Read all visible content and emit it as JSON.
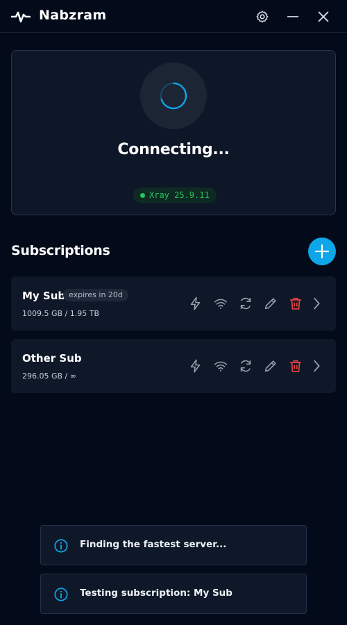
{
  "app": {
    "title": "Nabzram"
  },
  "titlebar": {
    "icons": [
      "pulse-logo-icon",
      "gear-icon",
      "minimize-icon",
      "close-icon"
    ]
  },
  "status": {
    "text": "Connecting...",
    "core_label": "Xray 25.9.11",
    "core_color": "#22c55e",
    "accent": "#0ea5e9"
  },
  "subscriptions": {
    "title": "Subscriptions",
    "items": [
      {
        "name": "My Sub",
        "badge": "expires in 20d",
        "usage": "1009.5 GB / 1.95 TB"
      },
      {
        "name": "Other Sub",
        "badge": "",
        "usage": "296.05 GB / ∞"
      }
    ],
    "actions": [
      "bolt-icon",
      "wifi-icon",
      "refresh-icon",
      "edit-icon",
      "trash-icon",
      "chevron-right-icon"
    ]
  },
  "toasts": [
    {
      "text": "Finding the fastest server..."
    },
    {
      "text": "Testing subscription: My Sub"
    }
  ]
}
